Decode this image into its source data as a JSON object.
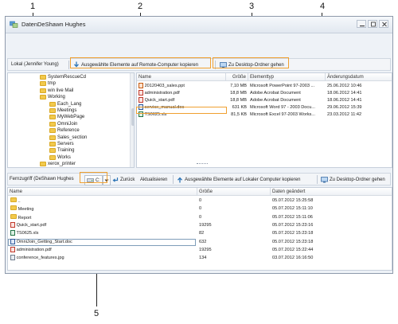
{
  "callouts": [
    "1",
    "2",
    "3",
    "4",
    "5"
  ],
  "window": {
    "title": "DatenDeShawn Hughes"
  },
  "local_toolbar": {
    "label": "Lokal (Jennifer Young)",
    "upload_button": "Ausgewählte Elemente auf Remote-Computer kopieren",
    "desktop_button": "Zu Desktop-Ordner gehen"
  },
  "local_tree": [
    {
      "label": "SystemRescueCd",
      "indent": 2
    },
    {
      "label": "tmp",
      "indent": 2
    },
    {
      "label": "win live Mail",
      "indent": 2
    },
    {
      "label": "Working",
      "indent": 2
    },
    {
      "label": "Each_Lang",
      "indent": 3
    },
    {
      "label": "Meetings",
      "indent": 3
    },
    {
      "label": "MyWebPage",
      "indent": 3
    },
    {
      "label": "OmniJoin",
      "indent": 3
    },
    {
      "label": "Reference",
      "indent": 3
    },
    {
      "label": "Sales_section",
      "indent": 3
    },
    {
      "label": "Servers",
      "indent": 3
    },
    {
      "label": "Training",
      "indent": 3
    },
    {
      "label": "Works",
      "indent": 3
    },
    {
      "label": "xerox_printer",
      "indent": 2
    }
  ],
  "local_files": {
    "columns": [
      "Name",
      "Größe",
      "Elementtyp",
      "Änderungsdatum"
    ],
    "rows": [
      {
        "icon": "ppt",
        "name": "20120403_sales.ppt",
        "size": "7,10 MB",
        "type": "Microsoft PowerPoint 97-2003 ...",
        "date": "25.06.2012 10:46"
      },
      {
        "icon": "pdf",
        "name": "administration.pdf",
        "size": "18,8 MB",
        "type": "Adobe Acrobat Document",
        "date": "18.06.2012 14:41"
      },
      {
        "icon": "pdf",
        "name": "Quick_start.pdf",
        "size": "18,8 MB",
        "type": "Adobe Acrobat Document",
        "date": "18.06.2012 14:41"
      },
      {
        "icon": "doc",
        "name": "service_manual.doc",
        "size": "631 KB",
        "type": "Microsoft Word 97 - 2003 Docu...",
        "date": "29.06.2012 15:39"
      },
      {
        "icon": "xls",
        "name": "TS0625.xls",
        "size": "81,5 KB",
        "type": "Microsoft Excel 97-2003 Works...",
        "date": "23.03.2012 11:42"
      }
    ]
  },
  "remote_toolbar": {
    "label": "Fernzugriff (DeShawn Hughes",
    "drive": "C:",
    "back_button": "Zurück",
    "refresh_button": "Aktualisieren",
    "download_button": "Ausgewählte Elemente auf Lokaler Computer kopieren",
    "desktop_button": "Zu Desktop-Ordner gehen"
  },
  "remote_files": {
    "columns": [
      "Name",
      "Größe",
      "Daten geändert"
    ],
    "rows": [
      {
        "icon": "folder",
        "name": "..",
        "size": "0",
        "date": "05.07.2012 15:25:58"
      },
      {
        "icon": "folder",
        "name": "Meeting",
        "size": "0",
        "date": "05.07.2012 15:11:10"
      },
      {
        "icon": "folder",
        "name": "Report",
        "size": "0",
        "date": "05.07.2012 15:11:06"
      },
      {
        "icon": "pdf",
        "name": "Quick_start.pdf",
        "size": "19295",
        "date": "05.07.2012 15:23:16"
      },
      {
        "icon": "xls",
        "name": "TS0625.xls",
        "size": "82",
        "date": "05.07.2012 15:23:18"
      },
      {
        "icon": "doc",
        "name": "OmniJoin_Getting_Start.doc",
        "size": "632",
        "date": "05.07.2012 15:23:18"
      },
      {
        "icon": "pdf",
        "name": "administration.pdf",
        "size": "19295",
        "date": "05.07.2012 15:22:44"
      },
      {
        "icon": "jpg",
        "name": "conference_features.jpg",
        "size": "134",
        "date": "03.07.2012 16:16:50"
      }
    ]
  },
  "colors": {
    "callout": "#f0a030",
    "folder": "#f2c94c",
    "window_bg": "#eef2f7"
  }
}
